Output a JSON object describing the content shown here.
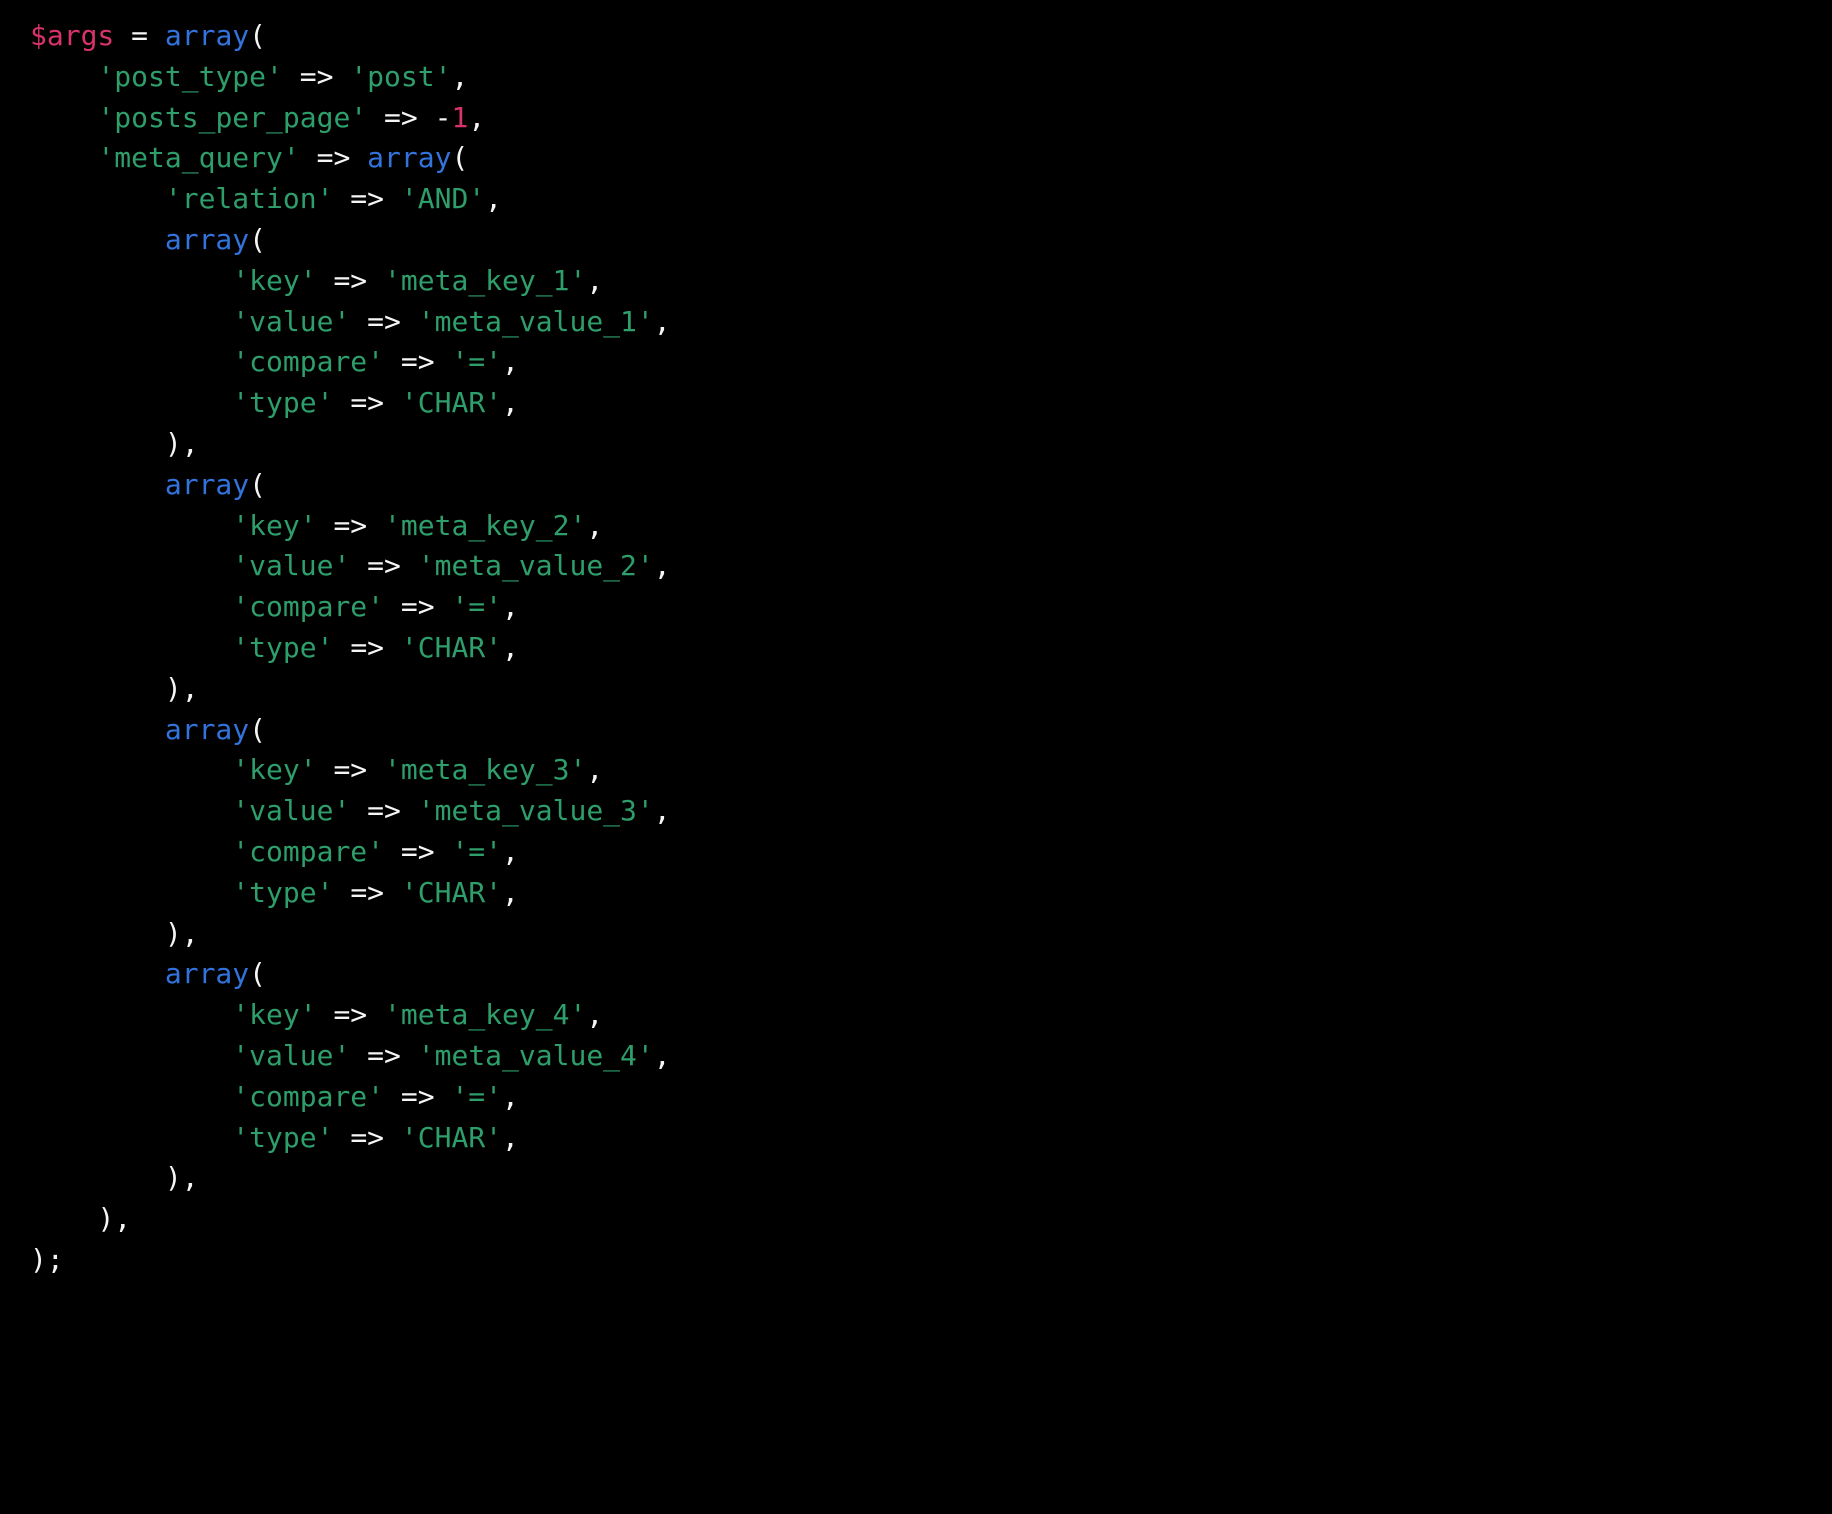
{
  "editor": {
    "language": "php",
    "background_color": "#000000",
    "theme_colors": {
      "variable": "#d8336b",
      "number": "#d8336b",
      "keyword": "#3273dc",
      "string": "#2e9e6b",
      "operator": "#f5f5f5",
      "punctuation": "#f5f5f5",
      "default_text": "#f5f5f5"
    },
    "font_size_px": 28,
    "line_height_px": 40.8,
    "indent_width_spaces": 4,
    "total_lines": 31
  },
  "code": {
    "plain_text": "$args = array(\n    'post_type' => 'post',\n    'posts_per_page' => -1,\n    'meta_query' => array(\n        'relation' => 'AND',\n        array(\n            'key' => 'meta_key_1',\n            'value' => 'meta_value_1',\n            'compare' => '=',\n            'type' => 'CHAR',\n        ),\n        array(\n            'key' => 'meta_key_2',\n            'value' => 'meta_value_2',\n            'compare' => '=',\n            'type' => 'CHAR',\n        ),\n        array(\n            'key' => 'meta_key_3',\n            'value' => 'meta_value_3',\n            'compare' => '=',\n            'type' => 'CHAR',\n        ),\n        array(\n            'key' => 'meta_key_4',\n            'value' => 'meta_value_4',\n            'compare' => '=',\n            'type' => 'CHAR',\n        ),\n    ),\n);",
    "lines": [
      {
        "indent": 0,
        "tokens": [
          {
            "t": "var",
            "v": "$args"
          },
          {
            "t": "plain",
            "v": " "
          },
          {
            "t": "op",
            "v": "="
          },
          {
            "t": "plain",
            "v": " "
          },
          {
            "t": "kw",
            "v": "array"
          },
          {
            "t": "punc",
            "v": "("
          }
        ]
      },
      {
        "indent": 1,
        "tokens": [
          {
            "t": "str",
            "v": "'post_type'"
          },
          {
            "t": "plain",
            "v": " "
          },
          {
            "t": "op",
            "v": "=>"
          },
          {
            "t": "plain",
            "v": " "
          },
          {
            "t": "str",
            "v": "'post'"
          },
          {
            "t": "punc",
            "v": ","
          }
        ]
      },
      {
        "indent": 1,
        "tokens": [
          {
            "t": "str",
            "v": "'posts_per_page'"
          },
          {
            "t": "plain",
            "v": " "
          },
          {
            "t": "op",
            "v": "=>"
          },
          {
            "t": "plain",
            "v": " "
          },
          {
            "t": "op",
            "v": "-"
          },
          {
            "t": "num",
            "v": "1"
          },
          {
            "t": "punc",
            "v": ","
          }
        ]
      },
      {
        "indent": 1,
        "tokens": [
          {
            "t": "str",
            "v": "'meta_query'"
          },
          {
            "t": "plain",
            "v": " "
          },
          {
            "t": "op",
            "v": "=>"
          },
          {
            "t": "plain",
            "v": " "
          },
          {
            "t": "kw",
            "v": "array"
          },
          {
            "t": "punc",
            "v": "("
          }
        ]
      },
      {
        "indent": 2,
        "tokens": [
          {
            "t": "str",
            "v": "'relation'"
          },
          {
            "t": "plain",
            "v": " "
          },
          {
            "t": "op",
            "v": "=>"
          },
          {
            "t": "plain",
            "v": " "
          },
          {
            "t": "str",
            "v": "'AND'"
          },
          {
            "t": "punc",
            "v": ","
          }
        ]
      },
      {
        "indent": 2,
        "tokens": [
          {
            "t": "kw",
            "v": "array"
          },
          {
            "t": "punc",
            "v": "("
          }
        ]
      },
      {
        "indent": 3,
        "tokens": [
          {
            "t": "str",
            "v": "'key'"
          },
          {
            "t": "plain",
            "v": " "
          },
          {
            "t": "op",
            "v": "=>"
          },
          {
            "t": "plain",
            "v": " "
          },
          {
            "t": "str",
            "v": "'meta_key_1'"
          },
          {
            "t": "punc",
            "v": ","
          }
        ]
      },
      {
        "indent": 3,
        "tokens": [
          {
            "t": "str",
            "v": "'value'"
          },
          {
            "t": "plain",
            "v": " "
          },
          {
            "t": "op",
            "v": "=>"
          },
          {
            "t": "plain",
            "v": " "
          },
          {
            "t": "str",
            "v": "'meta_value_1'"
          },
          {
            "t": "punc",
            "v": ","
          }
        ]
      },
      {
        "indent": 3,
        "tokens": [
          {
            "t": "str",
            "v": "'compare'"
          },
          {
            "t": "plain",
            "v": " "
          },
          {
            "t": "op",
            "v": "=>"
          },
          {
            "t": "plain",
            "v": " "
          },
          {
            "t": "str",
            "v": "'='"
          },
          {
            "t": "punc",
            "v": ","
          }
        ]
      },
      {
        "indent": 3,
        "tokens": [
          {
            "t": "str",
            "v": "'type'"
          },
          {
            "t": "plain",
            "v": " "
          },
          {
            "t": "op",
            "v": "=>"
          },
          {
            "t": "plain",
            "v": " "
          },
          {
            "t": "str",
            "v": "'CHAR'"
          },
          {
            "t": "punc",
            "v": ","
          }
        ]
      },
      {
        "indent": 2,
        "tokens": [
          {
            "t": "punc",
            "v": "),"
          }
        ]
      },
      {
        "indent": 2,
        "tokens": [
          {
            "t": "kw",
            "v": "array"
          },
          {
            "t": "punc",
            "v": "("
          }
        ]
      },
      {
        "indent": 3,
        "tokens": [
          {
            "t": "str",
            "v": "'key'"
          },
          {
            "t": "plain",
            "v": " "
          },
          {
            "t": "op",
            "v": "=>"
          },
          {
            "t": "plain",
            "v": " "
          },
          {
            "t": "str",
            "v": "'meta_key_2'"
          },
          {
            "t": "punc",
            "v": ","
          }
        ]
      },
      {
        "indent": 3,
        "tokens": [
          {
            "t": "str",
            "v": "'value'"
          },
          {
            "t": "plain",
            "v": " "
          },
          {
            "t": "op",
            "v": "=>"
          },
          {
            "t": "plain",
            "v": " "
          },
          {
            "t": "str",
            "v": "'meta_value_2'"
          },
          {
            "t": "punc",
            "v": ","
          }
        ]
      },
      {
        "indent": 3,
        "tokens": [
          {
            "t": "str",
            "v": "'compare'"
          },
          {
            "t": "plain",
            "v": " "
          },
          {
            "t": "op",
            "v": "=>"
          },
          {
            "t": "plain",
            "v": " "
          },
          {
            "t": "str",
            "v": "'='"
          },
          {
            "t": "punc",
            "v": ","
          }
        ]
      },
      {
        "indent": 3,
        "tokens": [
          {
            "t": "str",
            "v": "'type'"
          },
          {
            "t": "plain",
            "v": " "
          },
          {
            "t": "op",
            "v": "=>"
          },
          {
            "t": "plain",
            "v": " "
          },
          {
            "t": "str",
            "v": "'CHAR'"
          },
          {
            "t": "punc",
            "v": ","
          }
        ]
      },
      {
        "indent": 2,
        "tokens": [
          {
            "t": "punc",
            "v": "),"
          }
        ]
      },
      {
        "indent": 2,
        "tokens": [
          {
            "t": "kw",
            "v": "array"
          },
          {
            "t": "punc",
            "v": "("
          }
        ]
      },
      {
        "indent": 3,
        "tokens": [
          {
            "t": "str",
            "v": "'key'"
          },
          {
            "t": "plain",
            "v": " "
          },
          {
            "t": "op",
            "v": "=>"
          },
          {
            "t": "plain",
            "v": " "
          },
          {
            "t": "str",
            "v": "'meta_key_3'"
          },
          {
            "t": "punc",
            "v": ","
          }
        ]
      },
      {
        "indent": 3,
        "tokens": [
          {
            "t": "str",
            "v": "'value'"
          },
          {
            "t": "plain",
            "v": " "
          },
          {
            "t": "op",
            "v": "=>"
          },
          {
            "t": "plain",
            "v": " "
          },
          {
            "t": "str",
            "v": "'meta_value_3'"
          },
          {
            "t": "punc",
            "v": ","
          }
        ]
      },
      {
        "indent": 3,
        "tokens": [
          {
            "t": "str",
            "v": "'compare'"
          },
          {
            "t": "plain",
            "v": " "
          },
          {
            "t": "op",
            "v": "=>"
          },
          {
            "t": "plain",
            "v": " "
          },
          {
            "t": "str",
            "v": "'='"
          },
          {
            "t": "punc",
            "v": ","
          }
        ]
      },
      {
        "indent": 3,
        "tokens": [
          {
            "t": "str",
            "v": "'type'"
          },
          {
            "t": "plain",
            "v": " "
          },
          {
            "t": "op",
            "v": "=>"
          },
          {
            "t": "plain",
            "v": " "
          },
          {
            "t": "str",
            "v": "'CHAR'"
          },
          {
            "t": "punc",
            "v": ","
          }
        ]
      },
      {
        "indent": 2,
        "tokens": [
          {
            "t": "punc",
            "v": "),"
          }
        ]
      },
      {
        "indent": 2,
        "tokens": [
          {
            "t": "kw",
            "v": "array"
          },
          {
            "t": "punc",
            "v": "("
          }
        ]
      },
      {
        "indent": 3,
        "tokens": [
          {
            "t": "str",
            "v": "'key'"
          },
          {
            "t": "plain",
            "v": " "
          },
          {
            "t": "op",
            "v": "=>"
          },
          {
            "t": "plain",
            "v": " "
          },
          {
            "t": "str",
            "v": "'meta_key_4'"
          },
          {
            "t": "punc",
            "v": ","
          }
        ]
      },
      {
        "indent": 3,
        "tokens": [
          {
            "t": "str",
            "v": "'value'"
          },
          {
            "t": "plain",
            "v": " "
          },
          {
            "t": "op",
            "v": "=>"
          },
          {
            "t": "plain",
            "v": " "
          },
          {
            "t": "str",
            "v": "'meta_value_4'"
          },
          {
            "t": "punc",
            "v": ","
          }
        ]
      },
      {
        "indent": 3,
        "tokens": [
          {
            "t": "str",
            "v": "'compare'"
          },
          {
            "t": "plain",
            "v": " "
          },
          {
            "t": "op",
            "v": "=>"
          },
          {
            "t": "plain",
            "v": " "
          },
          {
            "t": "str",
            "v": "'='"
          },
          {
            "t": "punc",
            "v": ","
          }
        ]
      },
      {
        "indent": 3,
        "tokens": [
          {
            "t": "str",
            "v": "'type'"
          },
          {
            "t": "plain",
            "v": " "
          },
          {
            "t": "op",
            "v": "=>"
          },
          {
            "t": "plain",
            "v": " "
          },
          {
            "t": "str",
            "v": "'CHAR'"
          },
          {
            "t": "punc",
            "v": ","
          }
        ]
      },
      {
        "indent": 2,
        "tokens": [
          {
            "t": "punc",
            "v": "),"
          }
        ]
      },
      {
        "indent": 1,
        "tokens": [
          {
            "t": "punc",
            "v": "),"
          }
        ]
      },
      {
        "indent": 0,
        "tokens": [
          {
            "t": "punc",
            "v": ");"
          }
        ]
      }
    ]
  }
}
